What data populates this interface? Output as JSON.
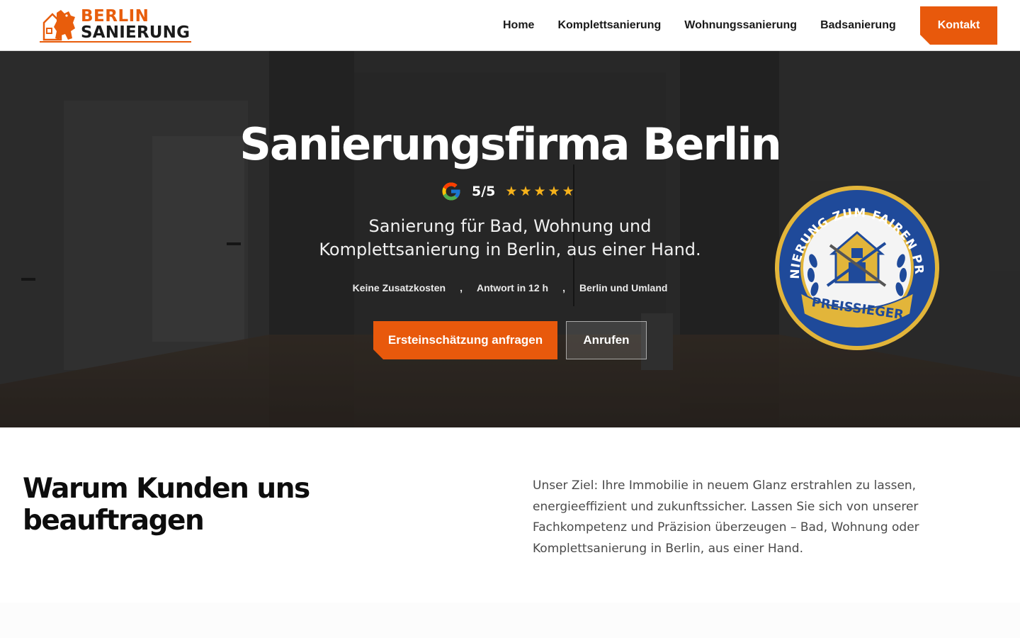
{
  "header": {
    "logo": {
      "line1": "BERLIN",
      "line2": "SANIERUNG"
    },
    "nav": [
      "Home",
      "Komplettsanierung",
      "Wohnungssanierung",
      "Badsanierung"
    ],
    "cta": "Kontakt"
  },
  "hero": {
    "title": "Sanierungsfirma Berlin",
    "rating": {
      "score": "5/5",
      "stars": 5,
      "provider_icon": "google-icon"
    },
    "subtitle": "Sanierung für Bad, Wohnung und Komplettsanierung in Berlin, aus einer Hand.",
    "features": [
      "Keine Zusatzkosten",
      "Antwort in 12 h",
      "Berlin und Umland"
    ],
    "separator": ",",
    "primary_button": "Ersteinschätzung anfragen",
    "secondary_button": "Anrufen",
    "seal": {
      "arc_text": "SANIERUNG ZUM FAIREN PREIS",
      "ribbon_text": "PREISSIEGER"
    }
  },
  "why": {
    "title": "Warum Kunden uns beauftragen",
    "text": "Unser Ziel: Ihre Immobilie in neuem Glanz erstrahlen zu lassen, energieeffizient und zukunftssicher. Lassen Sie sich von unserer Fachkompetenz und Präzision überzeugen – Bad, Wohnung oder Komplettsanierung in Berlin, aus einer Hand."
  },
  "colors": {
    "accent": "#e8590c",
    "star": "#f6b21b",
    "seal_blue": "#1f4a9a",
    "seal_gold": "#e2b53a"
  }
}
